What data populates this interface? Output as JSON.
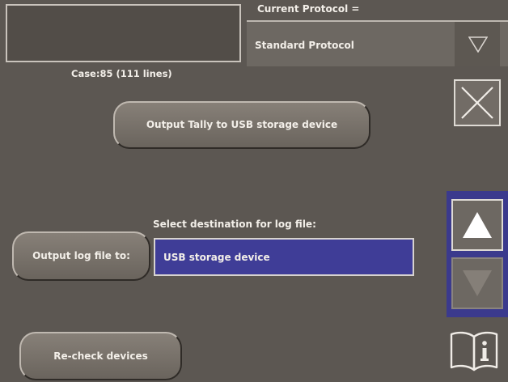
{
  "protocol": {
    "label": "Current Protocol =",
    "value": "Standard Protocol",
    "dropdown_icon": "triangle-down-outline-icon"
  },
  "case_info": "Case:85 (111 lines)",
  "buttons": {
    "output_tally": "Output Tally to USB storage device",
    "output_log": "Output log file to:",
    "recheck": "Re-check devices"
  },
  "destination": {
    "label": "Select destination for log file:",
    "value": "USB storage device"
  },
  "icons": {
    "close": "close-x-icon",
    "scroll_up": "triangle-up-icon",
    "scroll_down": "triangle-down-icon",
    "info": "manual-book-info-icon"
  },
  "colors": {
    "background": "#5c5752",
    "selection_blue": "#3f3d97",
    "scroll_panel": "#3b3a8d",
    "text": "#f3efe9"
  }
}
